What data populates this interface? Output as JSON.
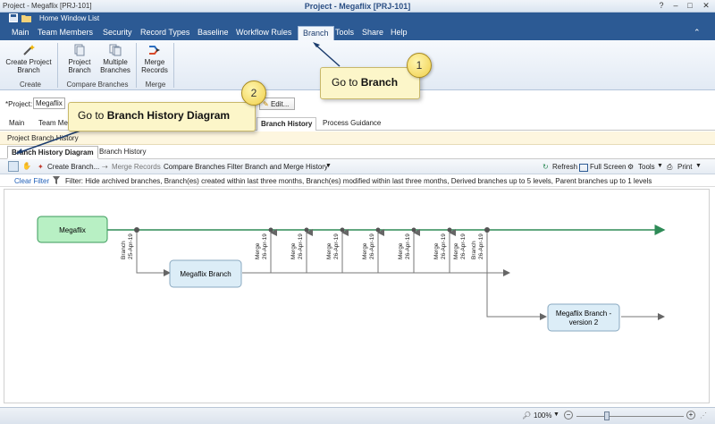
{
  "window": {
    "app_label": "Project - Megaflix [PRJ-101]",
    "title": "Project - Megaflix [PRJ-101]",
    "controls": [
      "?",
      "–",
      "□",
      "✕"
    ]
  },
  "quick_access": {
    "home": "Home",
    "window_list": "Window List"
  },
  "menu": {
    "items": [
      "Main",
      "Team Members",
      "Security",
      "Record Types",
      "Baseline",
      "Workflow Rules",
      "Branch",
      "Tools",
      "Share",
      "Help"
    ],
    "active": "Branch"
  },
  "ribbon": {
    "create_project_branch": "Create Project Branch",
    "project_branch": "Project Branch",
    "multiple_branches": "Multiple Branches",
    "merge_records": "Merge Records",
    "group_create": "Create",
    "group_compare": "Compare Branches",
    "group_merge": "Merge"
  },
  "project": {
    "label": "*Project:",
    "value": "Megaflix",
    "edit": "Edit..."
  },
  "tabs": {
    "main": "Main",
    "team": "Team Me",
    "branch_history": "Branch History",
    "process_guidance": "Process Guidance"
  },
  "breadcrumb": "Project Branch History",
  "subtabs": {
    "diagram": "Branch History Diagram",
    "history": "Branch History"
  },
  "toolbar": {
    "create_branch": "Create Branch...",
    "merge_records": "Merge Records",
    "compare_branches": "Compare Branches",
    "filter": "Filter Branch and Merge History",
    "refresh": "Refresh",
    "full_screen": "Full Screen",
    "tools": "Tools",
    "print": "Print"
  },
  "filter": {
    "clear": "Clear Filter",
    "text": "Filter: Hide archived branches, Branch(es) created within last three months, Branch(es) modified within last three months, Derived branches up to 5 levels, Parent branches up to 1 levels"
  },
  "diagram": {
    "node_main": "Megaflix",
    "node_branch": "Megaflix Branch",
    "node_branch2_line1": "Megaflix Branch -",
    "node_branch2_line2": "version 2",
    "event_branch1": "Branch",
    "event_branch1_date": "25-Apr-19",
    "merges": [
      {
        "label": "Merge",
        "date": "26-Apr-19"
      },
      {
        "label": "Merge",
        "date": "26-Apr-19"
      },
      {
        "label": "Merge",
        "date": "26-Apr-19"
      },
      {
        "label": "Merge",
        "date": "26-Apr-19"
      },
      {
        "label": "Merge",
        "date": "26-Apr-19"
      },
      {
        "label": "Merge",
        "date": "26-Apr-19"
      },
      {
        "label": "Merge",
        "date": "26-Apr-19"
      }
    ],
    "event_branch2": "Branch",
    "event_branch2_date": "26-Apr-19",
    "colors": {
      "main_line": "#2e8b57",
      "main_node": "#b8f0c4",
      "branch_node": "#dcedf7"
    }
  },
  "status": {
    "zoom": "100%"
  },
  "callouts": {
    "one_num": "1",
    "one_prefix": "Go to",
    "one_bold": "Branch",
    "two_num": "2",
    "two_prefix": "Go to",
    "two_bold": "Branch History Diagram"
  }
}
